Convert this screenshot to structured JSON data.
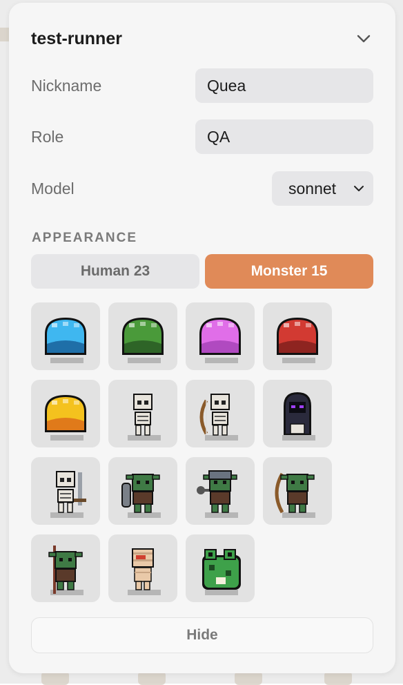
{
  "agent": {
    "title": "test-runner",
    "collapse_icon": "chevron-down-icon"
  },
  "fields": {
    "nickname": {
      "label": "Nickname",
      "value": "Quea"
    },
    "role": {
      "label": "Role",
      "value": "QA"
    },
    "model": {
      "label": "Model",
      "value": "sonnet",
      "icon": "chevron-down-icon"
    }
  },
  "appearance": {
    "section_label": "APPEARANCE",
    "tabs": [
      {
        "label": "Human 23",
        "active": false
      },
      {
        "label": "Monster 15",
        "active": true
      }
    ],
    "active_color": "#e08a58",
    "sprites": [
      {
        "name": "blue-slime-icon",
        "kind": "slime",
        "color": "#3fb7f0",
        "dark": "#1f6fa8"
      },
      {
        "name": "green-slime-icon",
        "kind": "slime",
        "color": "#4a9a3a",
        "dark": "#2e6427"
      },
      {
        "name": "pink-slime-icon",
        "kind": "slime",
        "color": "#e06ee8",
        "dark": "#b04ac0"
      },
      {
        "name": "red-slime-icon",
        "kind": "slime",
        "color": "#d23a32",
        "dark": "#8e2420"
      },
      {
        "name": "yellow-slime-icon",
        "kind": "slime",
        "color": "#f4c21e",
        "dark": "#e07a1a"
      },
      {
        "name": "skeleton-icon",
        "kind": "skeleton",
        "color": "#e8e4dc",
        "dark": "#222222"
      },
      {
        "name": "skeleton-archer-icon",
        "kind": "skeleton-bow",
        "color": "#e8e4dc",
        "dark": "#8a5a2a"
      },
      {
        "name": "hooded-wraith-icon",
        "kind": "hooded",
        "color": "#2a2a3c",
        "dark": "#a040ff"
      },
      {
        "name": "skeleton-swordsman-icon",
        "kind": "skeleton-sword",
        "color": "#e8e4dc",
        "dark": "#9aa0a8"
      },
      {
        "name": "orc-shield-icon",
        "kind": "orc-shield",
        "color": "#3f7a45",
        "dark": "#5a3a2a"
      },
      {
        "name": "orc-helmet-mace-icon",
        "kind": "orc-helmet",
        "color": "#3f7a45",
        "dark": "#6a7380"
      },
      {
        "name": "orc-archer-icon",
        "kind": "orc-bow",
        "color": "#3f7a45",
        "dark": "#8a5a2a"
      },
      {
        "name": "goblin-spear-icon",
        "kind": "goblin",
        "color": "#3f7a45",
        "dark": "#7a3a2a"
      },
      {
        "name": "mummy-icon",
        "kind": "mummy",
        "color": "#e9c9a8",
        "dark": "#d04030"
      },
      {
        "name": "frog-icon",
        "kind": "frog",
        "color": "#3ea14a",
        "dark": "#1c4a22"
      }
    ],
    "hide_label": "Hide"
  }
}
